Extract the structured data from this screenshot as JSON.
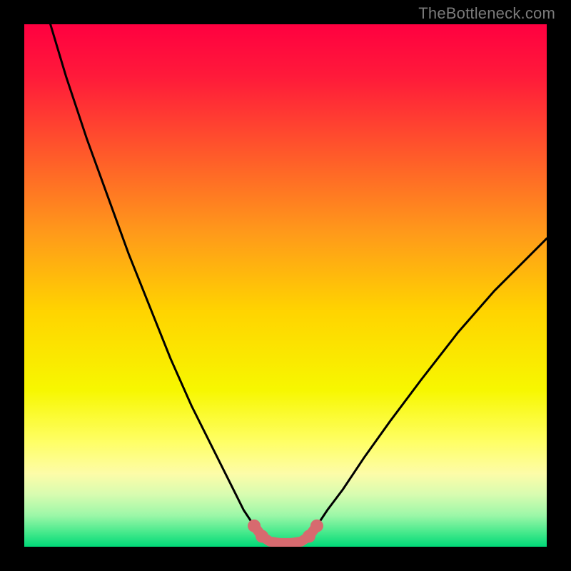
{
  "watermark": "TheBottleneck.com",
  "chart_data": {
    "type": "line",
    "title": "",
    "xlabel": "",
    "ylabel": "",
    "xlim": [
      0,
      100
    ],
    "ylim": [
      0,
      100
    ],
    "grid": false,
    "legend": false,
    "background": "rainbow-vertical",
    "series": [
      {
        "name": "curve-left",
        "x": [
          5,
          8,
          12,
          16,
          20,
          24,
          28,
          32,
          36,
          40,
          42,
          44,
          45.5
        ],
        "y": [
          100,
          90,
          78,
          67,
          56,
          46,
          36,
          27,
          19,
          11,
          7,
          4,
          2
        ]
      },
      {
        "name": "curve-right",
        "x": [
          54.5,
          56,
          58,
          61,
          65,
          70,
          76,
          83,
          90,
          96,
          100
        ],
        "y": [
          2,
          4,
          7,
          11,
          17,
          24,
          32,
          41,
          49,
          55,
          59
        ]
      },
      {
        "name": "flat-bottom",
        "x": [
          45.5,
          47,
          49,
          51,
          53,
          54.5
        ],
        "y": [
          2,
          1,
          0.7,
          0.7,
          1,
          2
        ]
      }
    ],
    "highlight": {
      "name": "salmon-segment",
      "x": [
        44,
        45.5,
        47,
        49,
        51,
        53,
        54.5,
        56
      ],
      "y": [
        4,
        2,
        1,
        0.7,
        0.7,
        1,
        2,
        4
      ]
    },
    "highlight_dots": {
      "x": [
        44,
        45.5,
        54.5,
        56
      ],
      "y": [
        4,
        2,
        2,
        4
      ]
    },
    "gradient_stops": [
      {
        "offset": 0.0,
        "color": "#ff0040"
      },
      {
        "offset": 0.1,
        "color": "#ff1a3a"
      },
      {
        "offset": 0.25,
        "color": "#ff5a2a"
      },
      {
        "offset": 0.4,
        "color": "#ff9a1a"
      },
      {
        "offset": 0.55,
        "color": "#ffd400"
      },
      {
        "offset": 0.7,
        "color": "#f7f700"
      },
      {
        "offset": 0.8,
        "color": "#ffff66"
      },
      {
        "offset": 0.86,
        "color": "#fdfca8"
      },
      {
        "offset": 0.9,
        "color": "#d8fcb0"
      },
      {
        "offset": 0.94,
        "color": "#9cf7a8"
      },
      {
        "offset": 0.975,
        "color": "#40e88a"
      },
      {
        "offset": 1.0,
        "color": "#00d878"
      }
    ]
  }
}
